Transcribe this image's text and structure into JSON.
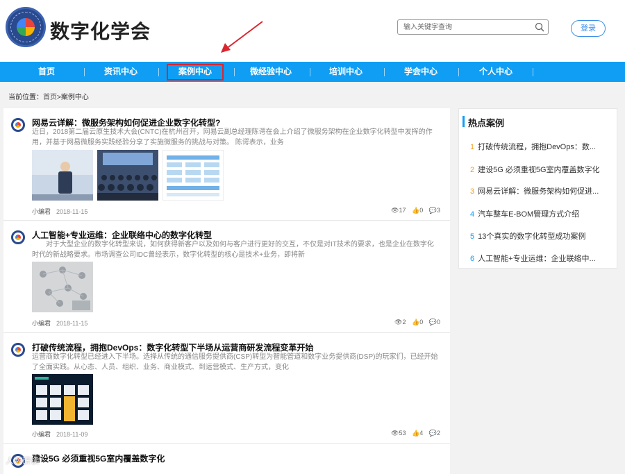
{
  "header": {
    "site_title": "数字化学会",
    "login_label": "登录"
  },
  "search": {
    "placeholder": "输入关键字查询"
  },
  "nav": {
    "items": [
      "首页",
      "资讯中心",
      "案例中心",
      "微经验中心",
      "培训中心",
      "学会中心",
      "个人中心"
    ],
    "active": "案例中心"
  },
  "breadcrumb": {
    "prefix": "当前位置：",
    "home": "首页",
    "sep": ">",
    "current": "案例中心"
  },
  "articles": [
    {
      "title": "网易云详解：微服务架构如何促进企业数字化转型?",
      "summary": "近日，2018第二届云原生技术大会(CNTC)在杭州召开，网易云副总经理陈谔在会上介绍了微服务架构在企业数字化转型中发挥的作用，并基于网易微服务实践经验分享了实施微服务的挑战与对策。 陈谔表示，业务",
      "author": "小编君",
      "date": "2018-11-15",
      "views": "17",
      "likes": "0",
      "comments": "3"
    },
    {
      "title": "人工智能+专业运维：企业联络中心的数字化转型",
      "summary": "对于大型企业的数字化转型来说，如何获得新客户以及如何与客户进行更好的交互，不仅是对IT技术的要求，也是企业在数字化时代的新战略要求。市场调查公司IDC曾经表示，数字化转型的核心是技术+业务，即将新",
      "author": "小编君",
      "date": "2018-11-15",
      "views": "2",
      "likes": "0",
      "comments": "0"
    },
    {
      "title": "打破传统流程，拥抱DevOps：数字化转型下半场从运营商研发流程变革开始",
      "summary": "运营商数字化转型已经进入下半场。选择从传统的通信服务提供商(CSP)转型为智能管道和数字业务提供商(DSP)的玩家们，已经开始了全面实践。从心态、人员、组织、业务、商业模式、到运营模式、生产方式，变化",
      "author": "小编君",
      "date": "2018-11-09",
      "views": "53",
      "likes": "4",
      "comments": "2"
    },
    {
      "title": "建设5G 必须重视5G室内覆盖数字化"
    }
  ],
  "sidebar": {
    "title": "热点案例",
    "items": [
      {
        "num": "1",
        "text": "打破传统流程，拥抱DevOps：数..."
      },
      {
        "num": "2",
        "text": "建设5G 必须重视5G室内覆盖数字化"
      },
      {
        "num": "3",
        "text": "网易云详解：微服务架构如何促进..."
      },
      {
        "num": "4",
        "text": "汽车整车E-BOM管理方式介绍"
      },
      {
        "num": "5",
        "text": "13个真实的数字化转型成功案例"
      },
      {
        "num": "6",
        "text": "人工智能+专业运维：企业联络中..."
      }
    ]
  },
  "watermark": "人数研读",
  "colors": {
    "nav_bg": "#0f9ef4",
    "highlight": "#d9262f",
    "hot_num_orange": "#f0a020"
  }
}
